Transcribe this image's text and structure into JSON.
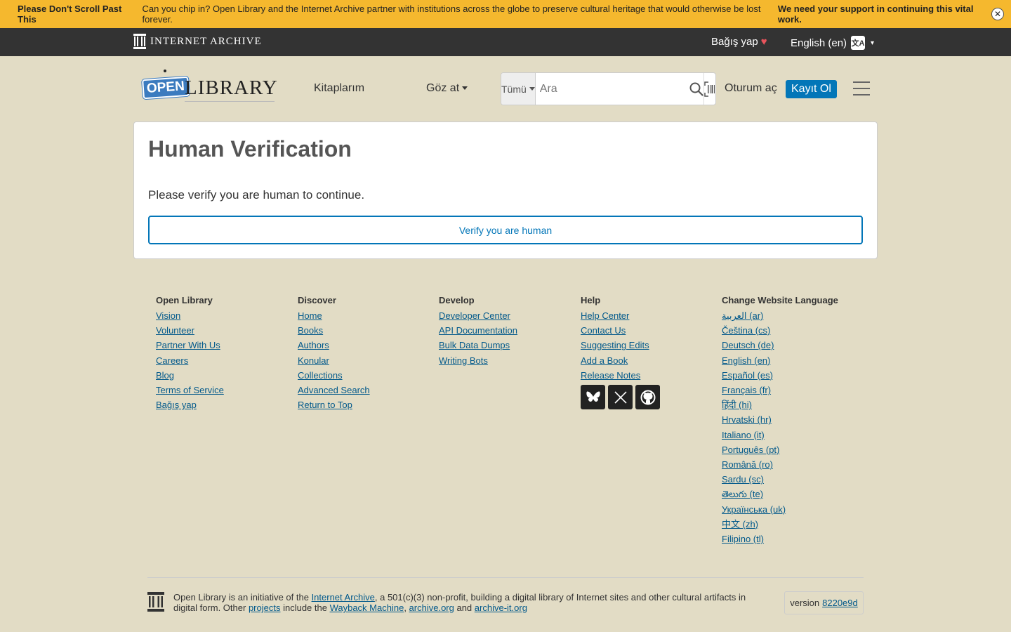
{
  "banner": {
    "bold": "Please Don't Scroll Past This",
    "text": "Can you chip in? Open Library and the Internet Archive partner with institutions across the globe to preserve cultural heritage that would otherwise be lost forever.",
    "strong": "We need your support in continuing this vital work.",
    "close_icon": "close-icon"
  },
  "ia_bar": {
    "logo_text": "INTERNET ARCHIVE",
    "donate": "Bağış yap",
    "donate_heart": "♥",
    "language": "English (en)",
    "language_icon": "translate-icon",
    "caret": "▾"
  },
  "header": {
    "logo_open": "OPEN",
    "logo_library": "LIBRARY",
    "my_books": "Kitaplarım",
    "browse": "Göz at",
    "search_scope": "Tümü",
    "search_placeholder": "Ara",
    "login": "Oturum aç",
    "signup": "Kayıt Ol"
  },
  "main": {
    "title": "Human Verification",
    "message": "Please verify you are human to continue.",
    "verify_button": "Verify you are human"
  },
  "footer": {
    "columns": [
      {
        "title": "Open Library",
        "links": [
          "Vision",
          "Volunteer",
          "Partner With Us",
          "Careers",
          "Blog",
          "Terms of Service",
          "Bağış yap"
        ]
      },
      {
        "title": "Discover",
        "links": [
          "Home",
          "Books",
          "Authors",
          "Konular",
          "Collections",
          "Advanced Search",
          "Return to Top"
        ]
      },
      {
        "title": "Develop",
        "links": [
          "Developer Center",
          "API Documentation",
          "Bulk Data Dumps",
          "Writing Bots"
        ]
      },
      {
        "title": "Help",
        "links": [
          "Help Center",
          "Contact Us",
          "Suggesting Edits",
          "Add a Book",
          "Release Notes"
        ]
      },
      {
        "title": "Change Website Language",
        "links": [
          "العربية (ar)",
          "Čeština (cs)",
          "Deutsch (de)",
          "English (en)",
          "Español (es)",
          "Français (fr)",
          "हिंदी (hi)",
          "Hrvatski (hr)",
          "Italiano (it)",
          "Português (pt)",
          "Română (ro)",
          "Sardu (sc)",
          "తెలుగు (te)",
          "Українська (uk)",
          "中文 (zh)",
          "Filipino (tl)"
        ]
      }
    ],
    "social_icons": [
      "bluesky-icon",
      "x-icon",
      "github-icon"
    ],
    "bottom": {
      "t1": "Open Library is an initiative of the ",
      "l1": "Internet Archive",
      "t2": ", a 501(c)(3) non-profit, building a digital library of Internet sites and other cultural artifacts in digital form. Other ",
      "l2": "projects",
      "t3": " include the ",
      "l3": "Wayback Machine",
      "t4": ", ",
      "l4": "archive.org",
      "t5": " and ",
      "l5": "archive-it.org"
    },
    "version_label": "version",
    "version_hash": "8220e9d"
  }
}
